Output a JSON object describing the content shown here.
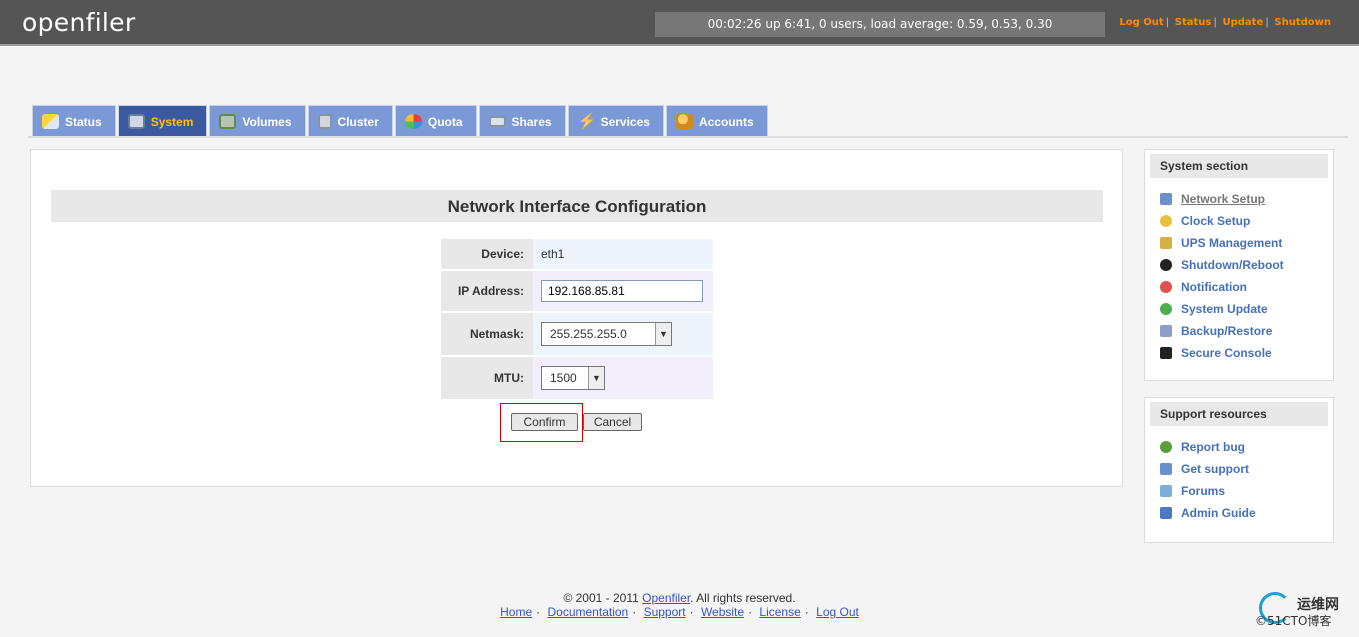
{
  "header": {
    "logo": "openfiler",
    "uptime": "00:02:26 up 6:41, 0 users, load average: 0.59, 0.53, 0.30",
    "links": [
      "Log Out",
      "Status",
      "Update",
      "Shutdown"
    ]
  },
  "tabs": [
    {
      "label": "Status",
      "icon": "sun-cloud-icon"
    },
    {
      "label": "System",
      "icon": "computer-icon",
      "active": true
    },
    {
      "label": "Volumes",
      "icon": "disk-icon"
    },
    {
      "label": "Cluster",
      "icon": "cluster-icon"
    },
    {
      "label": "Quota",
      "icon": "pie-icon"
    },
    {
      "label": "Shares",
      "icon": "drive-icon"
    },
    {
      "label": "Services",
      "icon": "lightning-icon"
    },
    {
      "label": "Accounts",
      "icon": "users-icon"
    }
  ],
  "main": {
    "title": "Network Interface Configuration",
    "device_label": "Device:",
    "device_value": "eth1",
    "ip_label": "IP Address:",
    "ip_value": "192.168.85.81",
    "netmask_label": "Netmask:",
    "netmask_value": "255.255.255.0",
    "mtu_label": "MTU:",
    "mtu_value": "1500",
    "confirm_label": "Confirm",
    "cancel_label": "Cancel"
  },
  "system_section": {
    "title": "System section",
    "items": [
      "Network Setup",
      "Clock Setup",
      "UPS Management",
      "Shutdown/Reboot",
      "Notification",
      "System Update",
      "Backup/Restore",
      "Secure Console"
    ]
  },
  "support": {
    "title": "Support resources",
    "items": [
      "Report bug",
      "Get support",
      "Forums",
      "Admin Guide"
    ]
  },
  "footer": {
    "copyright_pre": "© 2001 - 2011",
    "copyright_link": "Openfiler",
    "copyright_post": ". All rights reserved.",
    "links": [
      "Home",
      "Documentation",
      "Support",
      "Website",
      "License",
      "Log Out"
    ]
  },
  "watermark": {
    "line1": "运维网",
    "line2": "©51CTO博客"
  },
  "colors": {
    "accent": "#ff8a00",
    "tab": "#7a99d6",
    "tab_active": "#3c5aa0",
    "link": "#4670b8"
  }
}
